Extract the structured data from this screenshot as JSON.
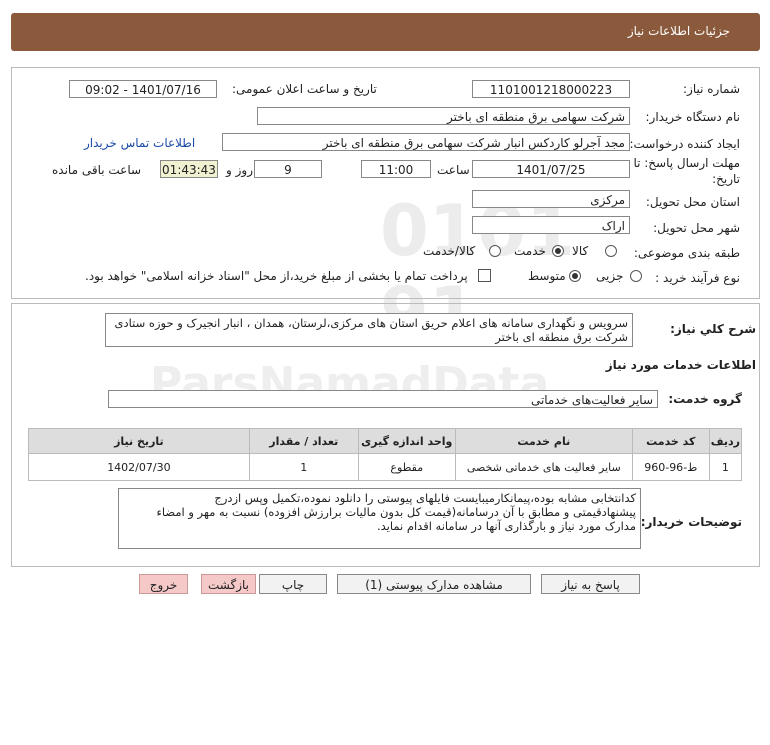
{
  "header": {
    "title": "جزئیات اطلاعات نیاز"
  },
  "fields": {
    "need_number_label": "شماره نیاز:",
    "need_number": "1101001218000223",
    "announce_label": "تاریخ و ساعت اعلان عمومی:",
    "announce_value": "1401/07/16 - 09:02",
    "buyer_label": "نام دستگاه خریدار:",
    "buyer_value": "شرکت سهامی برق منطقه ای باختر",
    "creator_label": "ایجاد کننده درخواست:",
    "creator_value": "مجد آجرلو کاردکس انبار شرکت سهامی برق منطقه ای باختر",
    "contact_link": "اطلاعات تماس خریدار",
    "deadline_label_1": "مهلت ارسال پاسخ: تا",
    "deadline_label_2": "تاریخ:",
    "deadline_date": "1401/07/25",
    "time_label": "ساعت",
    "deadline_time": "11:00",
    "days_value": "9",
    "days_label": "روز و",
    "remaining_time": "01:43:43",
    "remaining_label": "ساعت باقی مانده",
    "province_label": "استان محل تحویل:",
    "province_value": "مرکزی",
    "city_label": "شهر محل تحویل:",
    "city_value": "اراک",
    "category_label": "طبقه بندی موضوعی:",
    "category_options": [
      "کالا",
      "خدمت",
      "کالا/خدمت"
    ],
    "process_label": "نوع فرآیند خرید :",
    "process_options": [
      "جزیی",
      "متوسط"
    ],
    "payment_note": "پرداخت تمام یا بخشی از مبلغ خرید،از محل \"اسناد خزانه اسلامی\" خواهد بود."
  },
  "summary": {
    "label": "شرح کلي نیاز:",
    "text_line1": "سرویس و نگهداری سامانه های اعلام حریق استان های مرکزی،لرستان، همدان ، انبار انجیرک و حوزه ستادی",
    "text_line2": "شرکت برق منطقه ای باختر"
  },
  "services": {
    "section_title": "اطلاعات خدمات مورد نیاز",
    "group_label": "گروه خدمت:",
    "group_value": "سایر فعالیت‌های خدماتی",
    "columns": [
      "ردیف",
      "کد خدمت",
      "نام خدمت",
      "واحد اندازه گیری",
      "تعداد / مقدار",
      "تاریخ نیاز"
    ],
    "rows": [
      [
        "1",
        "ط-96-960",
        "سایر فعالیت های خدماتی شخصی",
        "مقطوع",
        "1",
        "1402/07/30"
      ]
    ]
  },
  "buyer_notes": {
    "label": "توضیحات خریدار:",
    "line1": "کدانتخابی مشابه بوده،پیمانکارمیبایست فایلهای پیوستی را دانلود نموده،تکمیل وپس ازدرج",
    "line2": "پیشنهادقیمتی و مطابق با آن درسامانه(قیمت کل بدون مالیات برارزش افزوده) نسبت به مهر و امضاء",
    "line3": "مدارک مورد نیاز و بارگذاری آنها در سامانه اقدام نماید."
  },
  "buttons": {
    "reply": "پاسخ به نیاز",
    "attachments": "مشاهده مدارک پیوستی (1)",
    "print": "چاپ",
    "back": "بازگشت",
    "exit": "خروج"
  },
  "watermark": {
    "text": "ParsNamadData"
  }
}
